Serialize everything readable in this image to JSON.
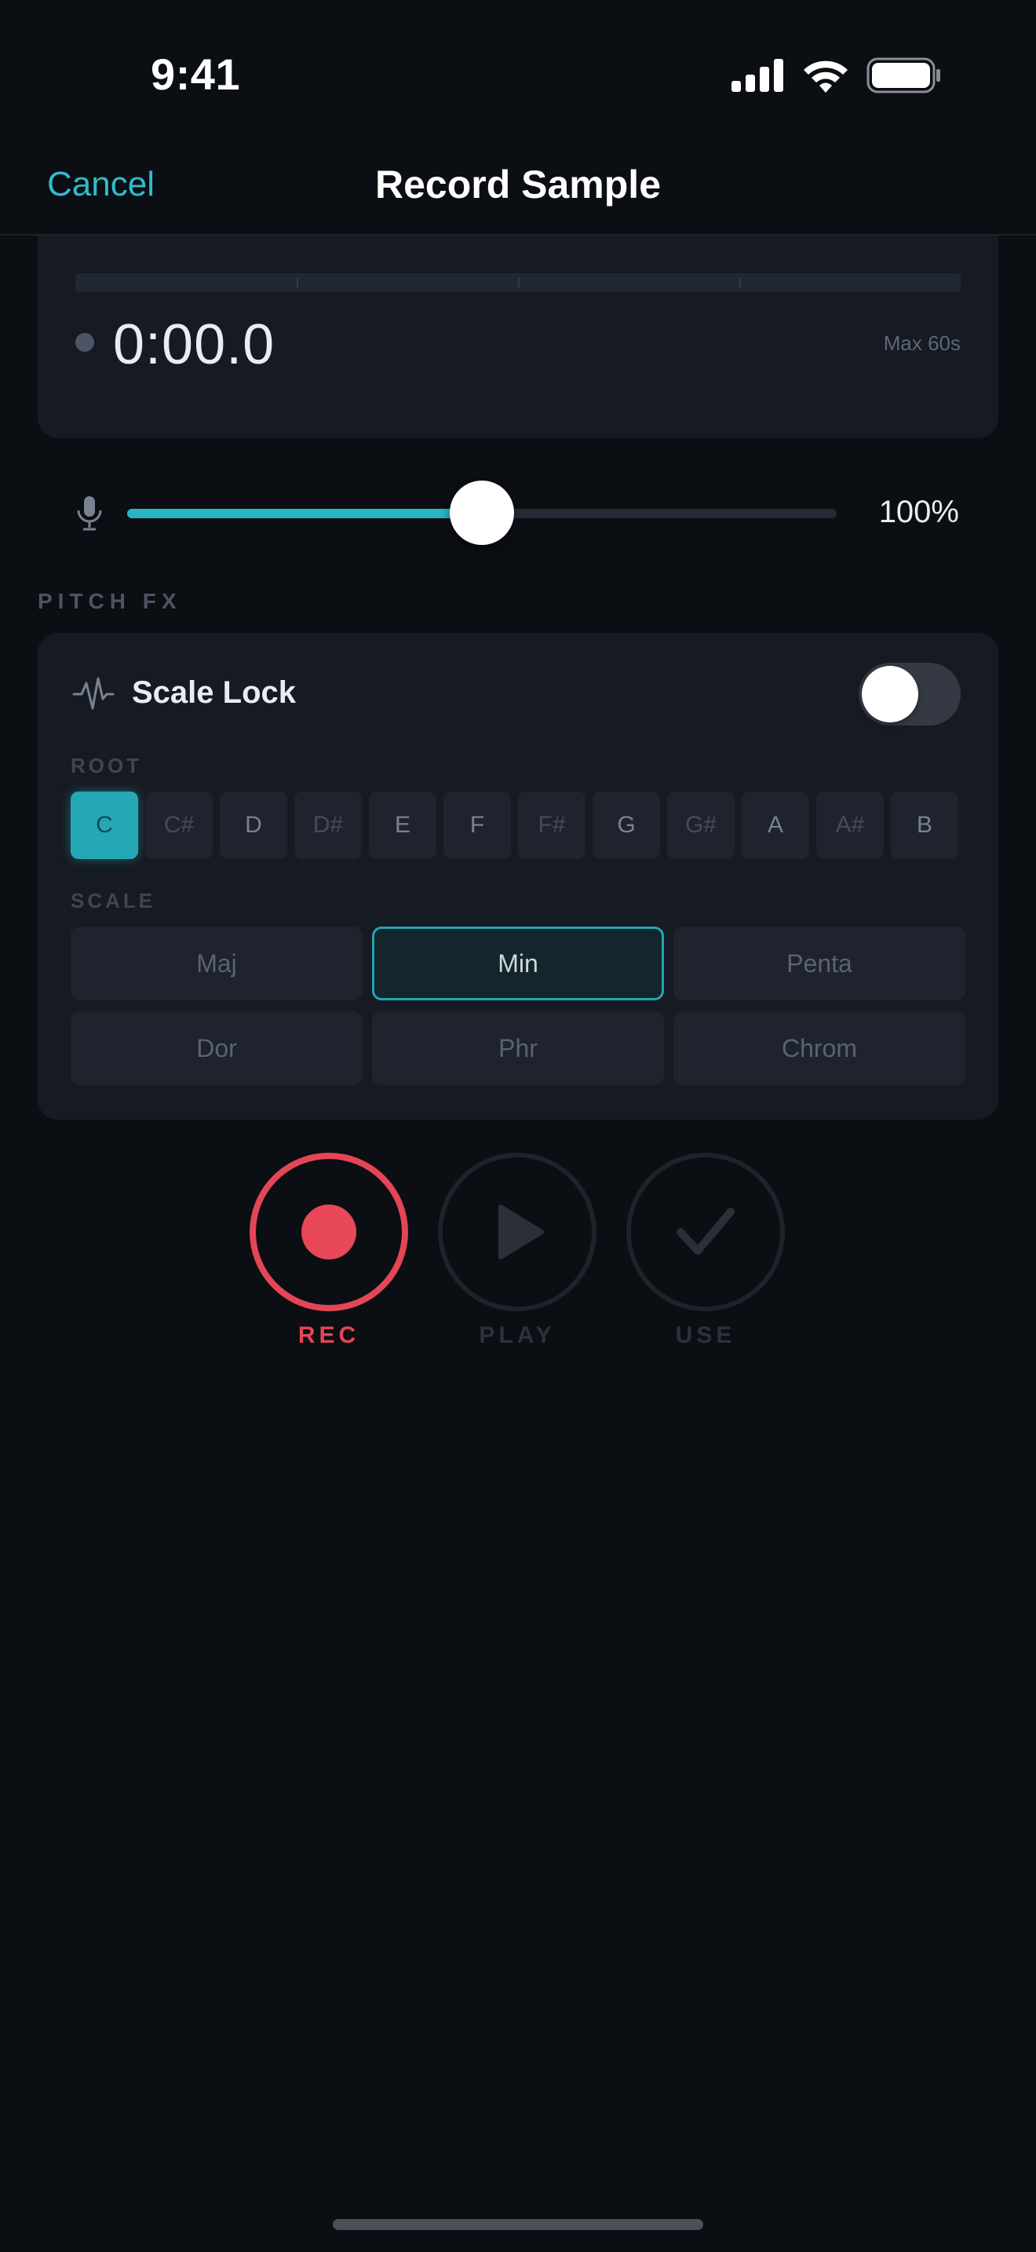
{
  "status_bar": {
    "time": "9:41",
    "icons": [
      "cellular-signal-icon",
      "wifi-icon",
      "battery-icon"
    ]
  },
  "nav": {
    "cancel_label": "Cancel",
    "title": "Record Sample"
  },
  "recorder": {
    "time": "0:00.0",
    "max_label": "Max 60s",
    "recording": false
  },
  "gain": {
    "icon": "microphone-icon",
    "value_label": "100%",
    "slider_fraction": 0.5
  },
  "pitch_fx": {
    "section_label": "PITCH FX",
    "scale_lock": {
      "icon": "waveform-icon",
      "label": "Scale Lock",
      "enabled": false
    },
    "root": {
      "label": "ROOT",
      "selected": "C",
      "keys": [
        "C",
        "C#",
        "D",
        "D#",
        "E",
        "F",
        "F#",
        "G",
        "G#",
        "A",
        "A#",
        "B"
      ]
    },
    "scale": {
      "label": "SCALE",
      "selected": "Min",
      "options": [
        "Maj",
        "Min",
        "Penta",
        "Dor",
        "Phr",
        "Chrom"
      ]
    }
  },
  "transport": {
    "rec_label": "REC",
    "play_label": "PLAY",
    "use_label": "USE"
  },
  "colors": {
    "accent": "#29b6c4",
    "record": "#e44655",
    "background": "#0b0e13",
    "card": "#161a22"
  }
}
